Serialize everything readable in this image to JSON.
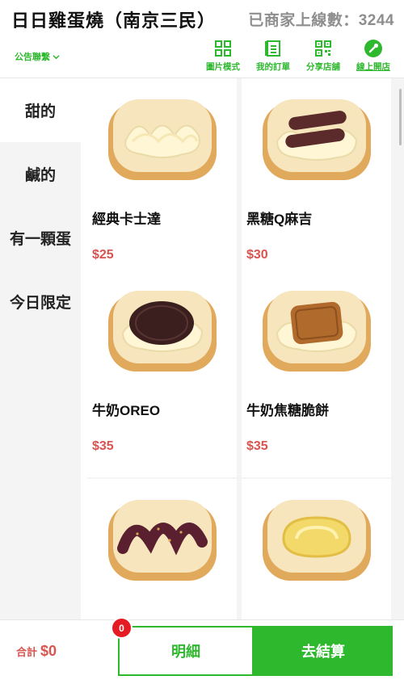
{
  "header": {
    "store_title": "日日雞蛋燒（南京三民）",
    "online_count": "已商家上線數：3244",
    "announcement": "公告聯繫",
    "tools": [
      {
        "label": "圖片模式",
        "icon": "grid-icon"
      },
      {
        "label": "我的訂單",
        "icon": "order-list-icon"
      },
      {
        "label": "分享店舖",
        "icon": "qr-code-icon"
      },
      {
        "label": "線上開店",
        "icon": "open-store-icon"
      }
    ]
  },
  "sidebar": {
    "categories": [
      {
        "label": "甜的",
        "active": true
      },
      {
        "label": "鹹的",
        "active": false
      },
      {
        "label": "有一顆蛋",
        "active": false
      },
      {
        "label": "今日限定",
        "active": false
      }
    ]
  },
  "products": [
    {
      "name": "經典卡士達",
      "price": "$25",
      "topping": "custard"
    },
    {
      "name": "黑糖Q麻吉",
      "price": "$30",
      "topping": "mochi"
    },
    {
      "name": "牛奶OREO",
      "price": "$35",
      "topping": "oreo"
    },
    {
      "name": "牛奶焦糖脆餅",
      "price": "$35",
      "topping": "lotus"
    },
    {
      "name": "",
      "price": "",
      "topping": "redbean"
    },
    {
      "name": "",
      "price": "",
      "topping": "cheese"
    }
  ],
  "cart": {
    "total_label": "合計",
    "total_amount": "$0",
    "badge_count": "0",
    "detail_label": "明細",
    "checkout_label": "去結算"
  },
  "colors": {
    "accent_green": "#2eb82e",
    "price_red": "#d9534f",
    "badge_red": "#e41b23"
  }
}
